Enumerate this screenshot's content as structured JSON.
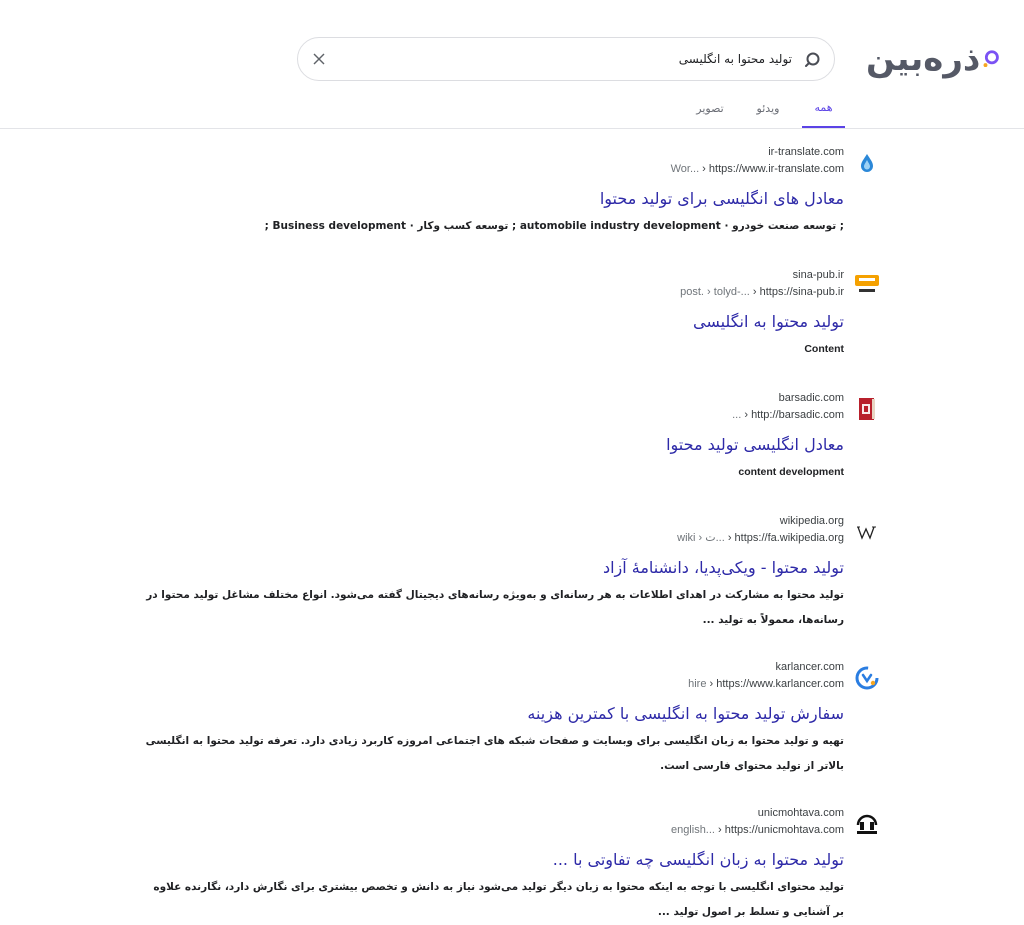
{
  "brand": {
    "name": "ذره‌بین",
    "accent": "#7b52f4"
  },
  "search": {
    "value": "تولید محتوا به انگلیسی",
    "placeholder": ""
  },
  "tabs": [
    {
      "label": "همه",
      "active": true
    },
    {
      "label": "ویدئو",
      "active": false
    },
    {
      "label": "تصویر",
      "active": false
    }
  ],
  "results": [
    {
      "site": "ir-translate.com",
      "url_base": "https://www.ir-translate.com",
      "url_path": "Wor...",
      "title": "معادل های انگلیسی برای تولید محتوا",
      "snippet": "; توسعه صنعت خودرو · automobile industry development ; توسعه کسب وکار · Business development ;",
      "favicon": "drop-logo-icon"
    },
    {
      "site": "sina-pub.ir",
      "url_base": "https://sina-pub.ir",
      "url_path": "post. › tolyd-...",
      "title": "تولید محتوا به انگلیسی",
      "snippet": "Content",
      "favicon": "sina-logo-icon"
    },
    {
      "site": "barsadic.com",
      "url_base": "http://barsadic.com",
      "url_path": "...",
      "title": "معادل انگلیسی تولید محتوا",
      "snippet": "content development",
      "favicon": "dictionary-book-icon"
    },
    {
      "site": "wikipedia.org",
      "url_base": "https://fa.wikipedia.org",
      "url_path": "wiki › ت...",
      "title": "تولید محتوا - ویکی‌پدیا، دانشنامهٔ آزاد",
      "snippet": "تولید محتوا به مشارکت در اهدای اطلاعات به هر رسانه‌ای و به‌ویژه رسانه‌های دیجیتال گفته می‌شود. انواع مختلف مشاغل تولید محتوا در رسانه‌ها، معمولاً به تولید ...",
      "favicon": "wikipedia-w-icon"
    },
    {
      "site": "karlancer.com",
      "url_base": "https://www.karlancer.com",
      "url_path": "hire",
      "title": "سفارش تولید محتوا به انگلیسی با کمترین هزینه",
      "snippet": "تهیه و تولید محتوا به زبان انگلیسی برای وبسایت و صفحات شبکه های اجتماعی امروزه کاربرد زیادی دارد. تعرفه تولید محتوا به انگلیسی بالاتر از تولید محتوای فارسی است.",
      "favicon": "karlancer-logo-icon"
    },
    {
      "site": "unicmohtava.com",
      "url_base": "https://unicmohtava.com",
      "url_path": "english...",
      "title": "تولید محتوا به زبان انگلیسی چه تفاوتی با ...",
      "snippet": "تولید محتوای انگلیسی با توجه به اینکه محتوا به زبان دیگر تولید می‌شود نیاز به دانش و تخصص بیشتری برای نگارش دارد، نگارنده علاوه بر آشنایی و تسلط بر اصول تولید ...",
      "favicon": "unicmohtava-logo-icon"
    }
  ]
}
